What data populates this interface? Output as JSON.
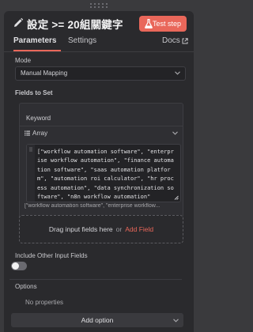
{
  "header": {
    "title": "設定 >= 20組關鍵字",
    "test_step_label": "Test step"
  },
  "tabs": {
    "parameters": "Parameters",
    "settings": "Settings",
    "docs": "Docs"
  },
  "mode": {
    "label": "Mode",
    "value": "Manual Mapping"
  },
  "fields": {
    "label": "Fields to Set",
    "items": [
      {
        "name": "Keyword",
        "type": "Array",
        "value": "[\"workflow automation software\", \"enterprise workflow automation\", \"finance automation software\", \"saas automation platform\", \"automation roi calculator\", \"hr process automation\", \"data synchronization software\", \"n8n workflow automation\"",
        "preview": "[\"workflow automation software\", \"enterprise workflow..."
      }
    ]
  },
  "drop_zone": {
    "text": "Drag input fields here",
    "or": "or",
    "add_field": "Add Field"
  },
  "include_other": {
    "label": "Include Other Input Fields",
    "enabled": false
  },
  "options": {
    "label": "Options",
    "empty_text": "No properties",
    "add_label": "Add option"
  },
  "colors": {
    "accent": "#e9675a",
    "panel_bg": "#2a2a2d",
    "canvas_bg": "#3a3a3d"
  }
}
